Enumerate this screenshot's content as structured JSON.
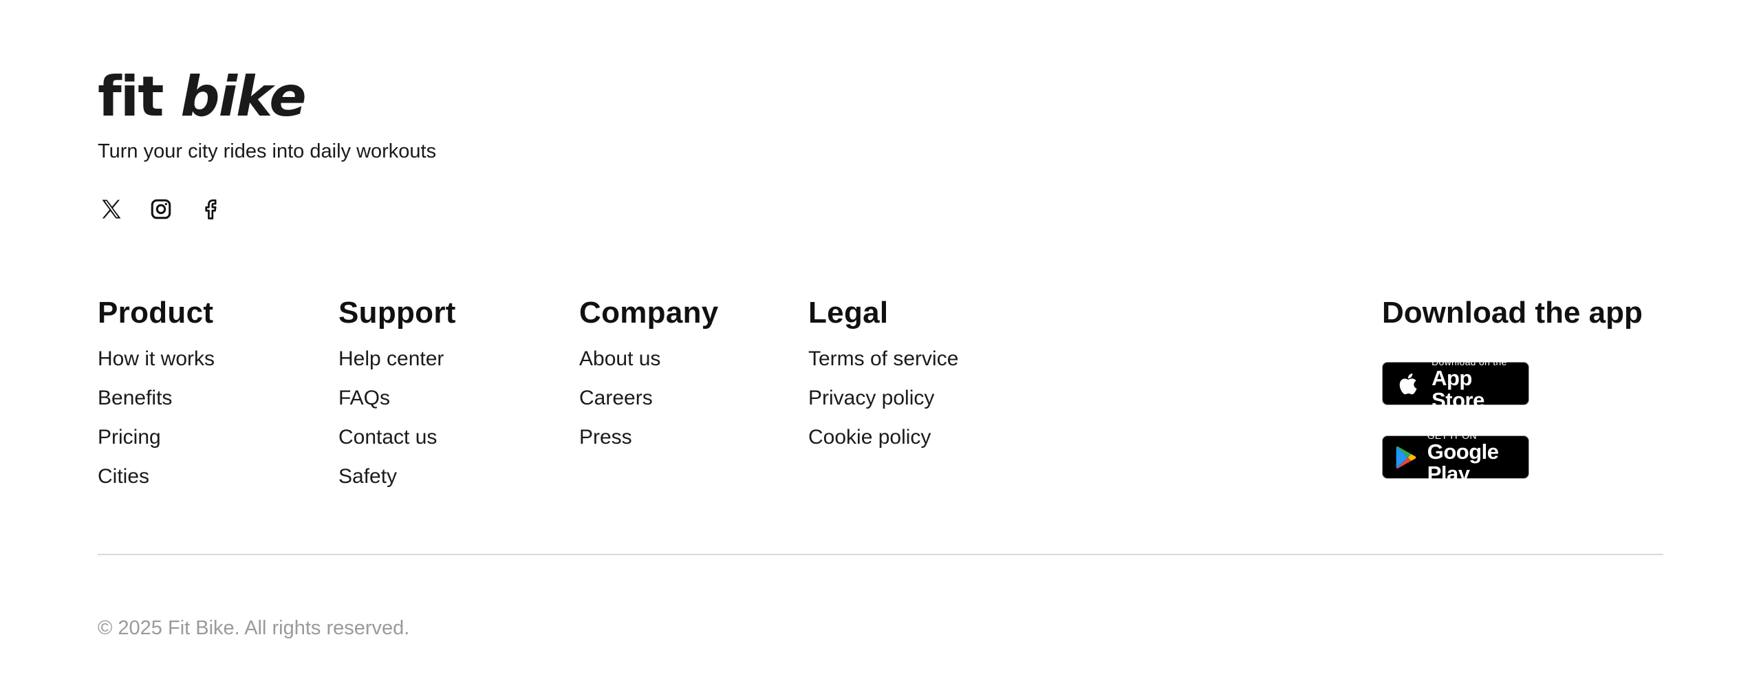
{
  "brand": {
    "logo_word1": "fit",
    "logo_word2": "bike",
    "tagline": "Turn your city rides into daily workouts"
  },
  "socials": [
    {
      "icon": "x-twitter-icon"
    },
    {
      "icon": "instagram-icon"
    },
    {
      "icon": "facebook-icon"
    }
  ],
  "columns": {
    "product": {
      "title": "Product",
      "links": [
        "How it works",
        "Benefits",
        "Pricing",
        "Cities"
      ]
    },
    "support": {
      "title": "Support",
      "links": [
        "Help center",
        "FAQs",
        "Contact us",
        "Safety"
      ]
    },
    "company": {
      "title": "Company",
      "links": [
        "About us",
        "Careers",
        "Press"
      ]
    },
    "legal": {
      "title": "Legal",
      "links": [
        "Terms of service",
        "Privacy policy",
        "Cookie policy"
      ]
    }
  },
  "app": {
    "title": "Download the app",
    "app_store": {
      "small": "Download on the",
      "big": "App Store",
      "icon": "apple-icon"
    },
    "google_play": {
      "small": "GET IT ON",
      "big": "Google Play",
      "icon": "google-play-icon"
    }
  },
  "footer": {
    "copyright": "© 2025 Fit Bike. All rights reserved."
  },
  "colors": {
    "text": "#111111",
    "muted": "#9a9a9a",
    "divider": "#d9d9d9",
    "badge_bg": "#000000"
  }
}
